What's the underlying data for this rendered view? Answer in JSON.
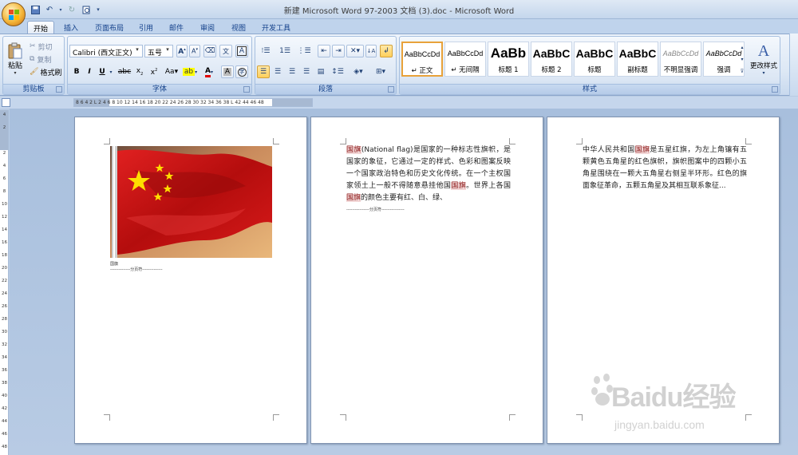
{
  "window": {
    "title": "新建 Microsoft Word 97-2003 文档 (3).doc - Microsoft Word"
  },
  "tabs": [
    "开始",
    "插入",
    "页面布局",
    "引用",
    "邮件",
    "审阅",
    "视图",
    "开发工具"
  ],
  "clipboard": {
    "paste": "粘贴",
    "cut": "剪切",
    "copy": "复制",
    "format_painter": "格式刷",
    "group_label": "剪贴板"
  },
  "font": {
    "name": "Calibri (西文正文)",
    "size": "五号",
    "group_label": "字体"
  },
  "paragraph": {
    "group_label": "段落"
  },
  "styles": {
    "group_label": "样式",
    "change_styles": "更改样式",
    "items": [
      {
        "sample": "AaBbCcDd",
        "name": "↵ 正文"
      },
      {
        "sample": "AaBbCcDd",
        "name": "↵ 无间隔"
      },
      {
        "sample": "AaBb",
        "name": "标题 1"
      },
      {
        "sample": "AaBbC",
        "name": "标题 2"
      },
      {
        "sample": "AaBbC",
        "name": "标题"
      },
      {
        "sample": "AaBbC",
        "name": "副标题"
      },
      {
        "sample": "AaBbCcDd",
        "name": "不明显强调"
      },
      {
        "sample": "AaBbCcDd",
        "name": "强调"
      }
    ]
  },
  "ruler": {
    "ticks": "8 6 4 2 L 2 4 6 8 10 12 14 16 18 20 22 24 26 28 30 32 34 36 38 L 42 44 46 48"
  },
  "vertical_ruler": {
    "ticks": [
      "4",
      "2",
      "",
      "2",
      "4",
      "6",
      "8",
      "10",
      "12",
      "14",
      "16",
      "18",
      "20",
      "22",
      "24",
      "26",
      "28",
      "30",
      "32",
      "34",
      "36",
      "38",
      "40",
      "42",
      "44",
      "46",
      "48"
    ]
  },
  "pages": [
    {
      "caption": "国旗",
      "page_break": "--------------分页符--------------"
    },
    {
      "segments": [
        {
          "t": "国旗",
          "kw": true
        },
        {
          "t": "(National flag)是国家的一种标志性旗帜，是国家的象征，它通过一定的样式、色彩和图案反映一个国家政治特色和历史文化传统。在一个主权国家领土上一般不得随意悬挂他国"
        },
        {
          "t": "国旗",
          "kw": true
        },
        {
          "t": "。世界上各国"
        },
        {
          "t": "国旗",
          "kw": true
        },
        {
          "t": "的颜色主要有红、白、绿、"
        }
      ],
      "page_break": "----------------分页符----------------"
    },
    {
      "segments": [
        {
          "t": "中华人民共和国"
        },
        {
          "t": "国旗",
          "kw": true
        },
        {
          "t": "是五星红旗，为左上角镶有五颗黄色五角星的红色旗帜，旗帜图案中的四颗小五角星围绕在一颗大五角星右侧呈半环形。红色的旗面象征革命，五颗五角星及其相互联系象征..."
        }
      ]
    }
  ],
  "watermark": {
    "brand": "Baidu经验",
    "url": "jingyan.baidu.com"
  },
  "colors": {
    "accent": "#15428b",
    "keyword_bg": "#f2d6d6",
    "flag_red": "#d11a1a",
    "star_yellow": "#ffde00"
  }
}
